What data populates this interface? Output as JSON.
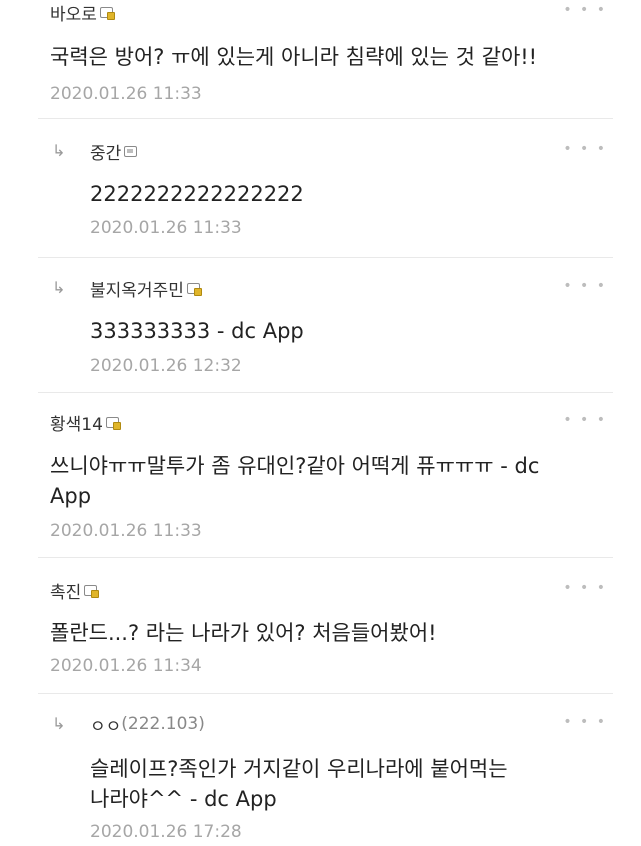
{
  "more_label": "• • •",
  "reply_arrow": "↳",
  "comments": [
    {
      "nick": "바오로",
      "text": "국력은 방어? ㅠ에 있는게 아니라 침략에 있는 것 같아!!",
      "date": "2020.01.26 11:33"
    },
    {
      "nick": "중간",
      "text": "2222222222222222",
      "date": "2020.01.26 11:33"
    },
    {
      "nick": "불지옥거주민",
      "text": "333333333 - dc App",
      "date": "2020.01.26 12:32"
    },
    {
      "nick": "황색14",
      "text_line1": "쓰니야ㅠㅠ말투가 좀 유대인?같아 어떡게 퓨ㅠㅠㅠ - dc",
      "text_line2": "App",
      "date": "2020.01.26 11:33"
    },
    {
      "nick": "촉진",
      "text": "폴란드...? 라는 나라가 있어? 처음들어봤어!",
      "date": "2020.01.26 11:34"
    },
    {
      "nick": "ㅇㅇ",
      "ip": "(222.103)",
      "text_line1": "슬레이프?족인가 거지같이 우리나라에 붙어먹는",
      "text_line2": "나라야^^ - dc App",
      "date": "2020.01.26 17:28"
    }
  ]
}
